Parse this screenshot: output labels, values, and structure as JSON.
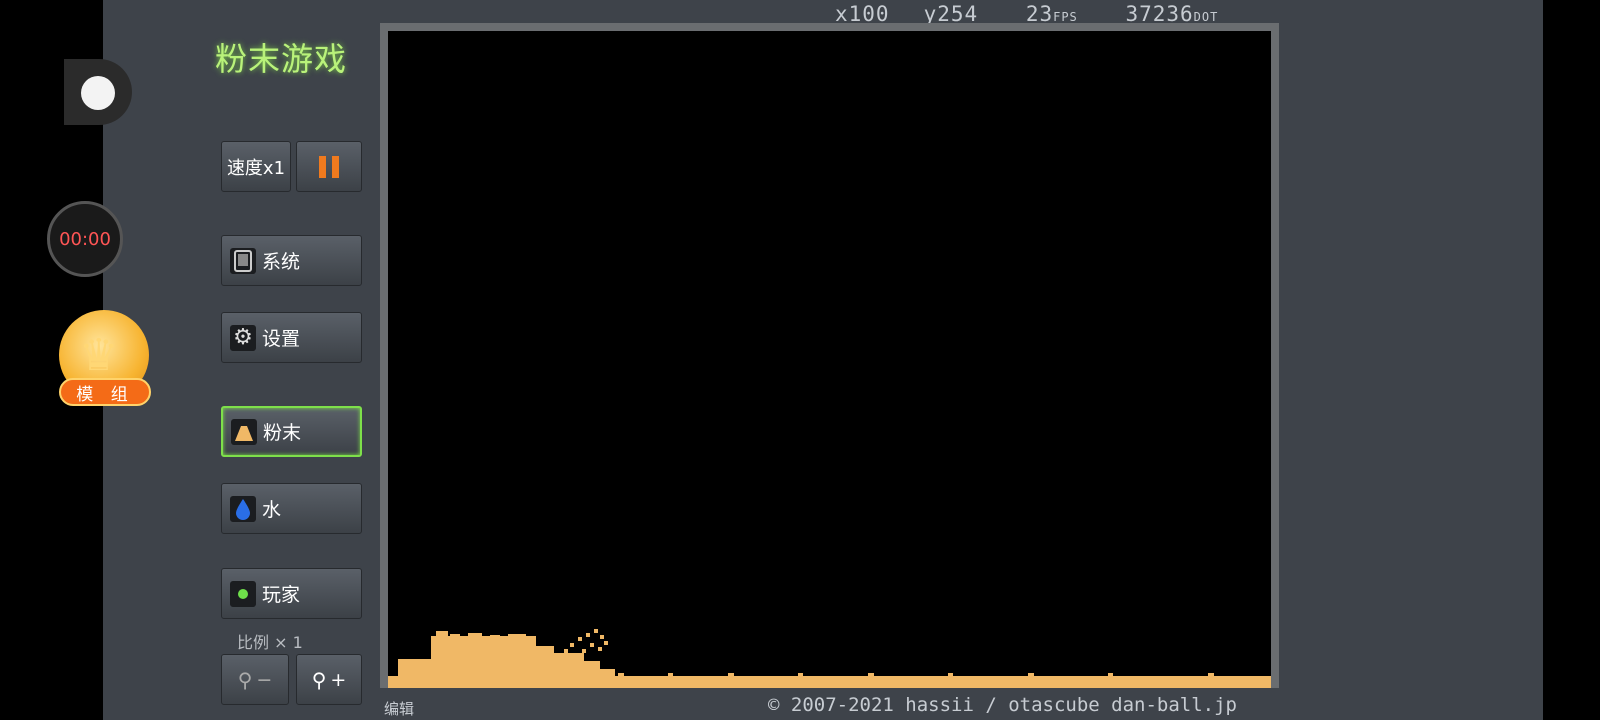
{
  "title": "粉末游戏",
  "overlay": {
    "timer": "00:00",
    "mod_badge": "模 组"
  },
  "controls": {
    "speed_label": "速度x1",
    "system_label": "系统",
    "settings_label": "设置",
    "powder_label": "粉末",
    "water_label": "水",
    "player_label": "玩家",
    "scale_label": "比例 × 1",
    "zoom_out_label": "−",
    "zoom_in_label": "+"
  },
  "stats": {
    "x": "x100",
    "y": "y254",
    "fps": "23",
    "fps_unit": "FPS",
    "dots": "37236",
    "dots_unit": "DOT"
  },
  "footer": {
    "edit_label": "编辑",
    "copyright": "© 2007-2021 hassii / otascube dan-ball.jp"
  },
  "colors": {
    "panel": "#3e434a",
    "title": "#b9f27a",
    "powder": "#f0b866",
    "selected_border": "#7ee04a",
    "pause_icon": "#f07a1e",
    "water_drop": "#2a6ee6",
    "player_dot": "#6ee04a"
  },
  "icons": {
    "pause": "pause-icon",
    "system": "tablet-icon",
    "settings": "gear-icon",
    "powder": "powder-pile-icon",
    "water": "water-drop-icon",
    "player": "player-dot-icon",
    "zoom_out": "magnifier-minus-icon",
    "zoom_in": "magnifier-plus-icon"
  }
}
